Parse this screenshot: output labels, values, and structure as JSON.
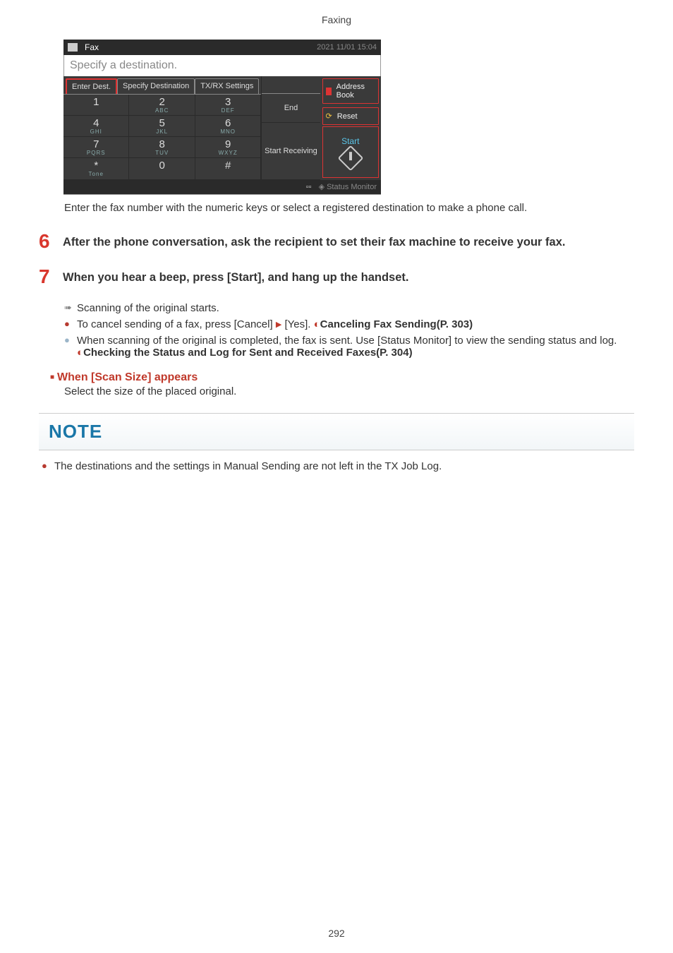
{
  "header": "Faxing",
  "screenshot": {
    "top": {
      "title": "Fax",
      "timestamp": "2021 11/01 15:04"
    },
    "subtitle": "Specify a destination.",
    "tabs": {
      "enter_dest": "Enter Dest.",
      "specify_dest": "Specify Destination",
      "txrx": "TX/RX Settings"
    },
    "keypad": {
      "1": {
        "num": "1",
        "letters": ""
      },
      "2": {
        "num": "2",
        "letters": "ABC"
      },
      "3": {
        "num": "3",
        "letters": "DEF"
      },
      "4": {
        "num": "4",
        "letters": "GHI"
      },
      "5": {
        "num": "5",
        "letters": "JKL"
      },
      "6": {
        "num": "6",
        "letters": "MNO"
      },
      "7": {
        "num": "7",
        "letters": "PQRS"
      },
      "8": {
        "num": "8",
        "letters": "TUV"
      },
      "9": {
        "num": "9",
        "letters": "WXYZ"
      },
      "star": {
        "num": "*",
        "letters": "Tone"
      },
      "0": {
        "num": "0",
        "letters": ""
      },
      "hash": {
        "num": "#",
        "letters": ""
      }
    },
    "side": {
      "end": "End",
      "start_receiving": "Start Receiving"
    },
    "right": {
      "address_book": "Address Book",
      "reset": "Reset",
      "start": "Start"
    },
    "bottom": {
      "status_monitor": "Status Monitor"
    }
  },
  "caption": "Enter the fax number with the numeric keys or select a registered destination to make a phone call.",
  "step6": {
    "num": "6",
    "title": "After the phone conversation, ask the recipient to set their fax machine to receive your fax."
  },
  "step7": {
    "num": "7",
    "title": "When you hear a beep, press [Start], and hang up the handset.",
    "line1": "Scanning of the original starts.",
    "line2a": "To cancel sending of a fax, press [Cancel] ",
    "line2b": " [Yes]. ",
    "line2_ref": "Canceling Fax Sending(P. 303)",
    "line3a": "When scanning of the original is completed, the fax is sent. Use [Status Monitor] to view the sending status and log. ",
    "line3_ref": "Checking the Status and Log for Sent and Received Faxes(P. 304)"
  },
  "scan_size": {
    "heading": "When [Scan Size] appears",
    "body": "Select the size of the placed original."
  },
  "note": {
    "label": "NOTE",
    "item": "The destinations and the settings in Manual Sending are not left in the TX Job Log."
  },
  "page_number": "292"
}
